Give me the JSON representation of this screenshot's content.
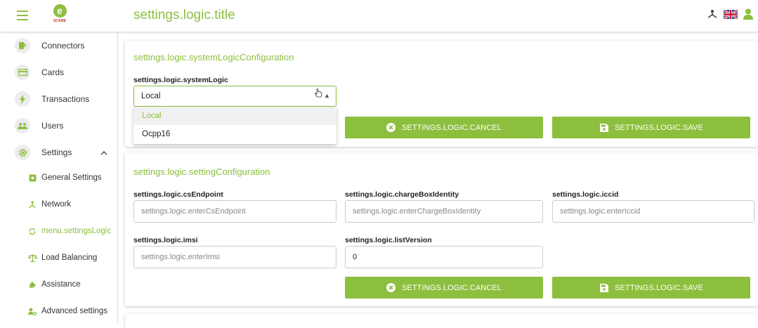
{
  "header": {
    "title": "settings.logic.title",
    "logo_text": "SCAME",
    "logo_letter": "e"
  },
  "icons": {
    "menu": "hamburger-icon",
    "network": "network-icon",
    "language": "uk-flag-icon",
    "user": "user-icon"
  },
  "colors": {
    "accent": "#8dbf3e",
    "logo_text": "#c0392b"
  },
  "sidebar": {
    "items": [
      {
        "label": "Connectors",
        "icon": "connector-icon"
      },
      {
        "label": "Cards",
        "icon": "card-icon"
      },
      {
        "label": "Transactions",
        "icon": "lightning-icon"
      },
      {
        "label": "Users",
        "icon": "users-icon"
      },
      {
        "label": "Settings",
        "icon": "gear-icon"
      }
    ],
    "sub_items": [
      {
        "label": "General Settings",
        "icon": "settings-box-icon"
      },
      {
        "label": "Network",
        "icon": "network-icon"
      },
      {
        "label": "menu.settingsLogic",
        "icon": "sync-icon",
        "active": true
      },
      {
        "label": "Load Balancing",
        "icon": "balance-icon"
      },
      {
        "label": "Assistance",
        "icon": "support-icon"
      },
      {
        "label": "Advanced settings",
        "icon": "user-gear-icon"
      }
    ]
  },
  "system_logic": {
    "title": "settings.logic.systemLogicConfiguration",
    "field_label": "settings.logic.systemLogic",
    "selected": "Local",
    "options": [
      "Local",
      "Ocpp16"
    ],
    "cancel": "SETTINGS.LOGIC.CANCEL",
    "save": "SETTINGS.LOGIC.SAVE"
  },
  "setting_config": {
    "title": "settings.logic.settingConfiguration",
    "fields": {
      "cs_endpoint": {
        "label": "settings.logic.csEndpoint",
        "placeholder": "settings.logic.enterCsEndpoint"
      },
      "charge_box_identity": {
        "label": "settings.logic.chargeBoxIdentity",
        "placeholder": "settings.logic.enterChargeBoxIdentity"
      },
      "iccid": {
        "label": "settings.logic.iccid",
        "placeholder": "settings.logic.enterIccid"
      },
      "imsi": {
        "label": "settings.logic.imsi",
        "placeholder": "settings.logic.enterImsi"
      },
      "list_version": {
        "label": "settings.logic.listVersion",
        "value": "0"
      }
    },
    "cancel": "SETTINGS.LOGIC.CANCEL",
    "save": "SETTINGS.LOGIC.SAVE"
  }
}
